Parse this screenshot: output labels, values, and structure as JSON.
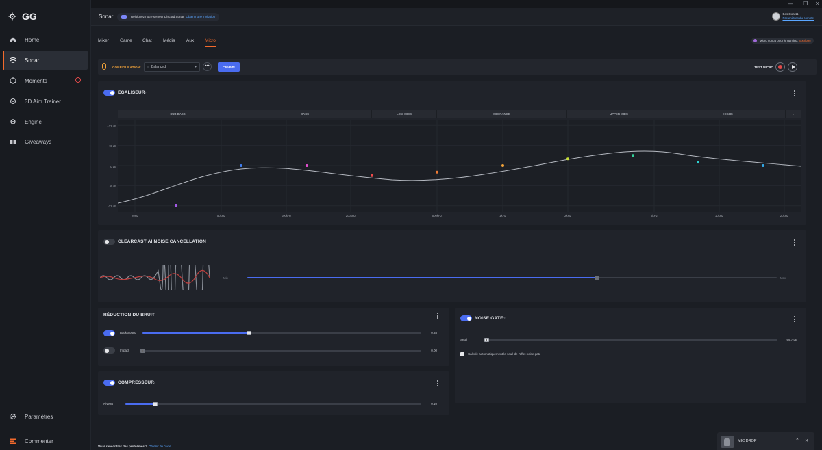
{
  "app": {
    "brand": "GG"
  },
  "sidebar": {
    "items": [
      {
        "label": "Home",
        "icon": "home-icon"
      },
      {
        "label": "Sonar",
        "icon": "sonar-icon"
      },
      {
        "label": "Moments",
        "icon": "moments-icon"
      },
      {
        "label": "3D Aim Trainer",
        "icon": "aim-icon"
      },
      {
        "label": "Engine",
        "icon": "engine-icon"
      },
      {
        "label": "Giveaways",
        "icon": "gift-icon"
      }
    ],
    "settings_label": "Paramètres",
    "feedback_label": "Commenter"
  },
  "header": {
    "title": "Sonar",
    "discord_text": "Rejoignez notre serveur Discord Sonar",
    "discord_link": "Obtenir une invitation",
    "user_name": "BestCoat11",
    "user_link": "Paramètres du compte"
  },
  "tabs": [
    "Mixer",
    "Game",
    "Chat",
    "Média",
    "Aux",
    "Micro"
  ],
  "active_tab": "Micro",
  "promo": {
    "text": "Micro conçu pour le gaming.",
    "link": "Explorer"
  },
  "config": {
    "label": "CONFIGURATION:",
    "preset": "Balanced",
    "share": "Partager",
    "test_label": "TEST MICRO"
  },
  "equalizer": {
    "title": "ÉGALISEUR",
    "enabled": true,
    "bands": [
      "SUB BASS",
      "BASS",
      "LOW MIDS",
      "MID RANGE",
      "UPPER MIDS",
      "HIGHS"
    ],
    "y_ticks": [
      "+12 dB",
      "+6 dB",
      "0 dB",
      "-6 dB",
      "-12 dB"
    ],
    "x_ticks": [
      "20Hz",
      "50kHz",
      "100kHz",
      "200kHz",
      "500kHz",
      "1kHz",
      "2kHz",
      "5kHz",
      "10kHz",
      "20kHz"
    ],
    "points": [
      {
        "db": -12,
        "color": "#a35ae6"
      },
      {
        "db": 0,
        "color": "#3e7df0"
      },
      {
        "db": 0,
        "color": "#e44fd0"
      },
      {
        "db": -3,
        "color": "#ee4a4a"
      },
      {
        "db": -2,
        "color": "#f07a33"
      },
      {
        "db": 0,
        "color": "#f0a23a"
      },
      {
        "db": 2,
        "color": "#c8e034"
      },
      {
        "db": 3,
        "color": "#33d29a"
      },
      {
        "db": 1,
        "color": "#2ed3d3"
      },
      {
        "db": 0,
        "color": "#33a8e6"
      }
    ]
  },
  "clearcast": {
    "title": "CLEARCAST AI NOISE CANCELLATION",
    "enabled": false,
    "min_label": "Min",
    "max_label": "Max",
    "level": 0.66
  },
  "noise_reduction": {
    "title": "RÉDUCTION DU BRUIT",
    "rows": [
      {
        "label": "Background",
        "value": "0.38",
        "enabled": true,
        "level": 0.38
      },
      {
        "label": "Impact",
        "value": "0.00",
        "enabled": false,
        "level": 0
      }
    ]
  },
  "noise_gate": {
    "title": "NOISE GATE",
    "enabled": true,
    "threshold_label": "Seuil",
    "threshold_value": "-59.7 dB",
    "level": 0.01,
    "auto_label": "Calcule automatiquement le seuil de l'effet noise gate"
  },
  "compressor": {
    "title": "COMPRESSEUR",
    "enabled": true,
    "row_label": "Niveau",
    "value": "0.10",
    "level": 0.1
  },
  "footer": {
    "help_text": "Vous rencontrez des problèmes ?",
    "help_link": "Obtenir de l'aide"
  },
  "mini_player": {
    "title": "MIC DROP"
  },
  "colors": {
    "accent": "#f36a2c",
    "toggle": "#4a6cf0",
    "link": "#5aa6ff"
  }
}
